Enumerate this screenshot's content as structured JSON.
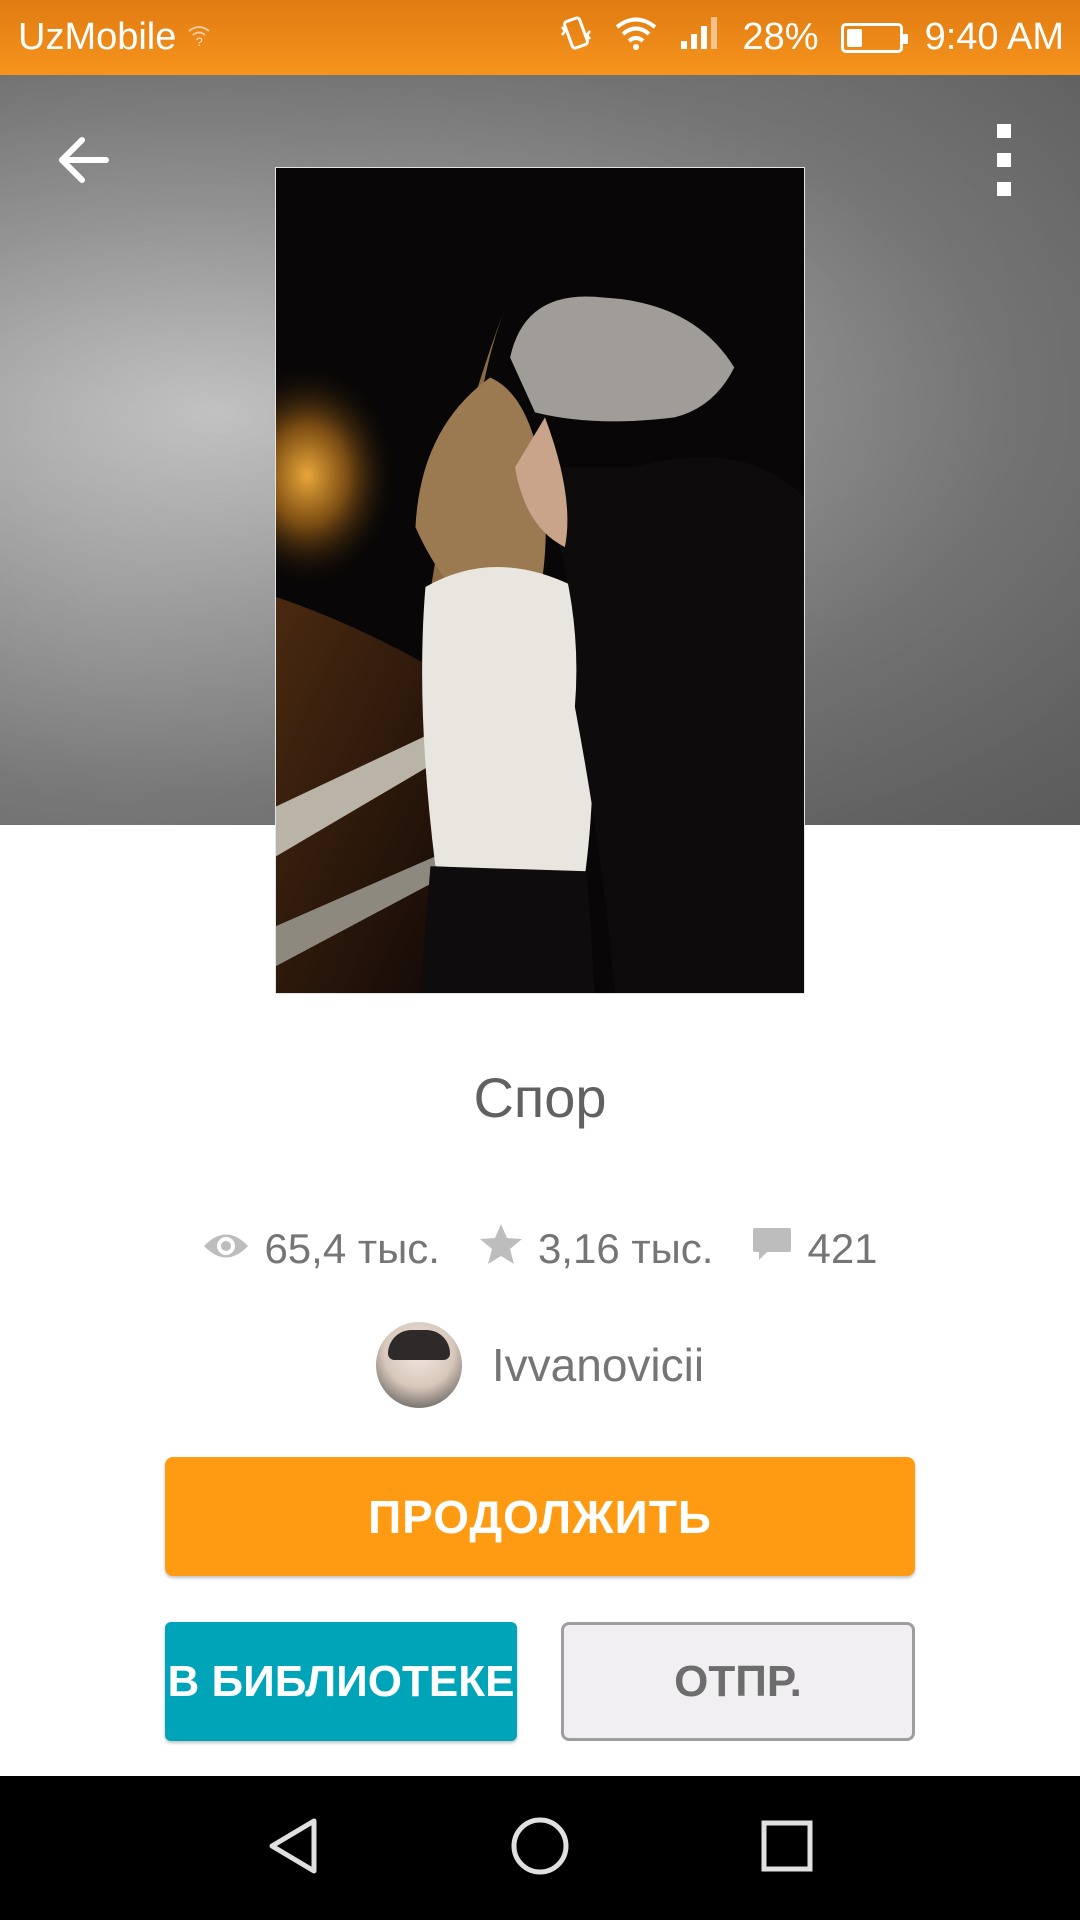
{
  "status_bar": {
    "carrier": "UzMobile",
    "battery_percent": "28%",
    "battery_level": 0.28,
    "time": "9:40 AM"
  },
  "header": {
    "back_icon": "arrow-left-icon",
    "menu_icon": "more-vert-icon"
  },
  "story": {
    "title": "Спор",
    "stats": {
      "reads": "65,4 тыс.",
      "votes": "3,16 тыс.",
      "comments": "421"
    },
    "author": "Ivvanovicii"
  },
  "actions": {
    "continue_label": "ПРОДОЛЖИТЬ",
    "library_label": "В БИБЛИОТЕКЕ",
    "send_label": "ОТПР."
  },
  "colors": {
    "status_bar": "#f7941d",
    "continue_button": "#ff9b13",
    "library_button": "#00a4b9",
    "send_button_bg": "#f1eff1",
    "text_gray": "#757575"
  },
  "nav_bar": {
    "icons": [
      "back-triangle-icon",
      "home-circle-icon",
      "recents-square-icon"
    ]
  }
}
